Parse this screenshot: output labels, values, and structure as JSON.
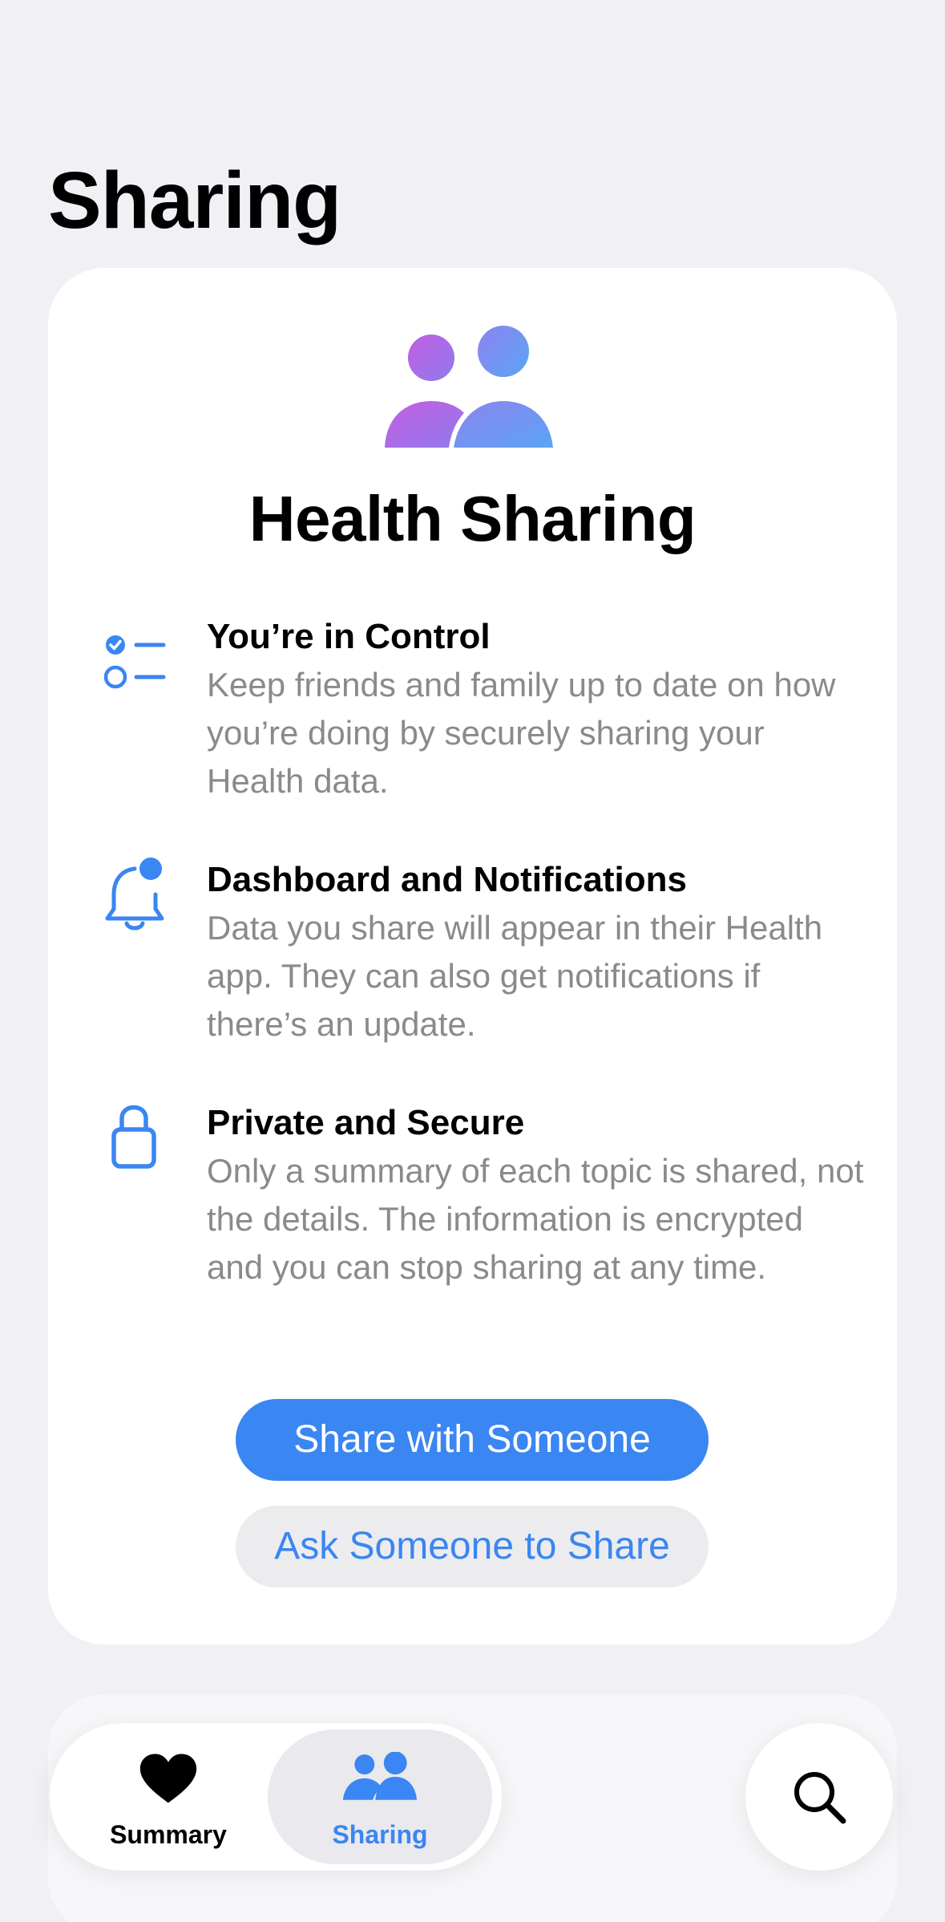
{
  "header": {
    "title": "Sharing"
  },
  "card": {
    "title": "Health Sharing",
    "features": [
      {
        "icon": "checklist-icon",
        "title": "You’re in Control",
        "description": "Keep friends and family up to date on how you’re doing by securely sharing your Health data."
      },
      {
        "icon": "bell-badge-icon",
        "title": "Dashboard and Notifications",
        "description": "Data you share will appear in their Health app. They can also get notifications if there’s an update."
      },
      {
        "icon": "lock-icon",
        "title": "Private and Secure",
        "description": "Only a summary of each topic is shared, not the details. The information is encrypted and you can stop sharing at any time."
      }
    ],
    "primary_button": "Share with Someone",
    "secondary_button": "Ask Someone to Share"
  },
  "tabbar": {
    "tabs": [
      {
        "label": "Summary",
        "icon": "heart-icon",
        "selected": false
      },
      {
        "label": "Sharing",
        "icon": "people-icon",
        "selected": true
      }
    ],
    "search_icon": "search-icon"
  },
  "colors": {
    "accent": "#3a86f2",
    "background": "#f1f1f5",
    "secondary_text": "#8a8a8e",
    "gradient_purple": "#c35ee0",
    "gradient_blue": "#5aa4f5"
  }
}
